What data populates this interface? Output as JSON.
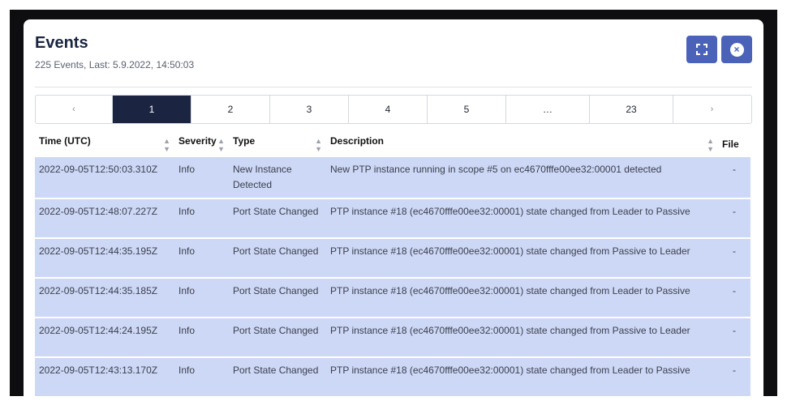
{
  "header": {
    "title": "Events",
    "subtitle": "225 Events, Last: 5.9.2022, 14:50:03"
  },
  "buttons": {
    "close_glyph": "×"
  },
  "pagination": [
    {
      "label": "‹",
      "kind": "prev"
    },
    {
      "label": "1",
      "kind": "page",
      "active": true
    },
    {
      "label": "2",
      "kind": "page"
    },
    {
      "label": "3",
      "kind": "page"
    },
    {
      "label": "4",
      "kind": "page"
    },
    {
      "label": "5",
      "kind": "page"
    },
    {
      "label": "…",
      "kind": "ellipsis"
    },
    {
      "label": "23",
      "kind": "page"
    },
    {
      "label": "›",
      "kind": "next"
    }
  ],
  "table": {
    "columns": [
      "Time (UTC)",
      "Severity",
      "Type",
      "Description",
      "File"
    ],
    "rows": [
      {
        "time": "2022-09-05T12:50:03.310Z",
        "severity": "Info",
        "type": "New Instance Detected",
        "description": "New PTP instance running in scope #5 on ec4670fffe00ee32:00001 detected",
        "file": "-"
      },
      {
        "time": "2022-09-05T12:48:07.227Z",
        "severity": "Info",
        "type": "Port State Changed",
        "description": "PTP instance #18 (ec4670fffe00ee32:00001) state changed from Leader to Passive",
        "file": "-"
      },
      {
        "time": "2022-09-05T12:44:35.195Z",
        "severity": "Info",
        "type": "Port State Changed",
        "description": "PTP instance #18 (ec4670fffe00ee32:00001) state changed from Passive to Leader",
        "file": "-"
      },
      {
        "time": "2022-09-05T12:44:35.185Z",
        "severity": "Info",
        "type": "Port State Changed",
        "description": "PTP instance #18 (ec4670fffe00ee32:00001) state changed from Leader to Passive",
        "file": "-"
      },
      {
        "time": "2022-09-05T12:44:24.195Z",
        "severity": "Info",
        "type": "Port State Changed",
        "description": "PTP instance #18 (ec4670fffe00ee32:00001) state changed from Passive to Leader",
        "file": "-"
      },
      {
        "time": "2022-09-05T12:43:13.170Z",
        "severity": "Info",
        "type": "Port State Changed",
        "description": "PTP instance #18 (ec4670fffe00ee32:00001) state changed from Leader to Passive",
        "file": "-"
      }
    ]
  },
  "colors": {
    "accent": "#4a63b8",
    "active_page": "#1b2440",
    "row_background": "#cdd8f6",
    "frame": "#0e0e10"
  },
  "icons": {
    "expand": "fullscreen-icon",
    "close": "close-icon",
    "sort": "sort-icon"
  }
}
